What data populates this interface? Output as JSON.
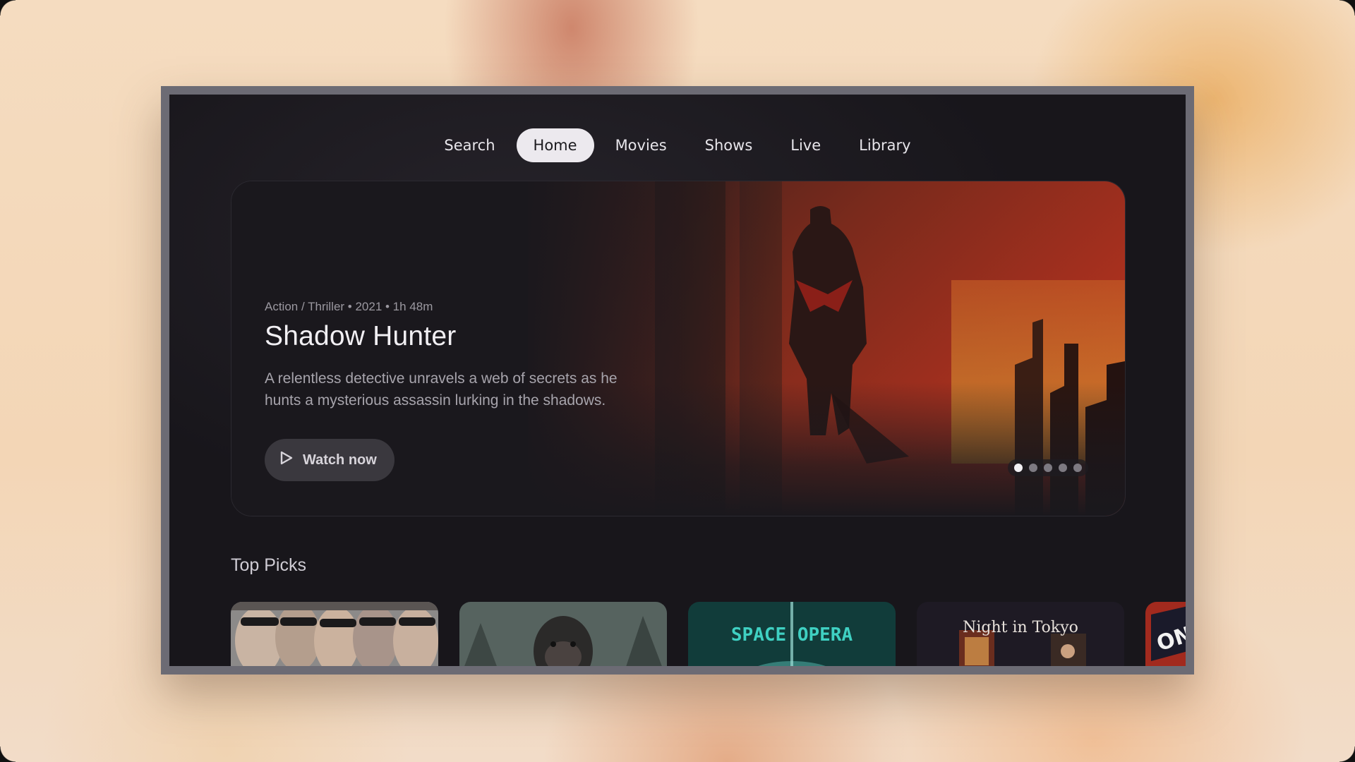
{
  "nav": {
    "items": [
      {
        "label": "Search"
      },
      {
        "label": "Home",
        "active": true
      },
      {
        "label": "Movies"
      },
      {
        "label": "Shows"
      },
      {
        "label": "Live"
      },
      {
        "label": "Library"
      }
    ]
  },
  "hero": {
    "meta": "Action / Thriller • 2021 • 1h 48m",
    "title": "Shadow Hunter",
    "description": "A relentless detective unravels a web of secrets as he hunts a mysterious assassin lurking in the shadows.",
    "watch_label": "Watch now",
    "watch_icon": "play-icon",
    "carousel": {
      "count": 5,
      "active_index": 0
    }
  },
  "top_picks": {
    "title": "Top Picks",
    "cards": [
      {
        "name": "card-sunglasses-group",
        "text": ""
      },
      {
        "name": "card-ape",
        "text": ""
      },
      {
        "name": "card-space-opera",
        "text": "SPACE OPERA"
      },
      {
        "name": "card-night-in-tokyo",
        "text": "Night in Tokyo"
      },
      {
        "name": "card-partial",
        "text": "ON"
      }
    ]
  },
  "colors": {
    "accent_active_nav": "#ece9ee",
    "hero_red": "#b8321f",
    "screen_bg": "#19171c"
  }
}
